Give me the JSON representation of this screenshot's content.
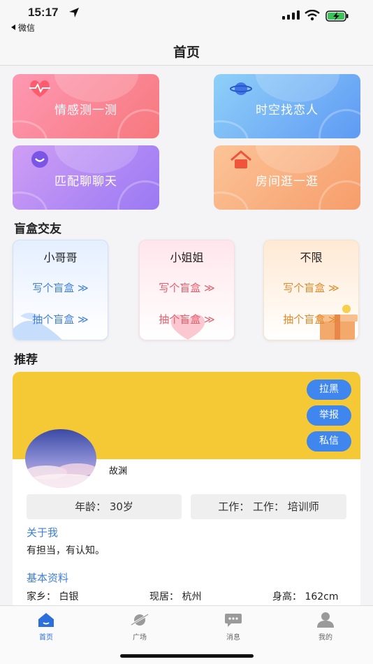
{
  "status_bar": {
    "time": "15:17",
    "back_app": "微信"
  },
  "nav": {
    "title": "首页"
  },
  "features": [
    {
      "label": "情感测一测",
      "icon": "heart-pulse-icon"
    },
    {
      "label": "时空找恋人",
      "icon": "planet-icon"
    },
    {
      "label": "匹配聊聊天",
      "icon": "smile-icon"
    },
    {
      "label": "房间逛一逛",
      "icon": "house-icon"
    }
  ],
  "blind_box": {
    "title": "盲盒交友",
    "cards": [
      {
        "title": "小哥哥",
        "write": "写个盲盒 ≫",
        "draw": "抽个盲盒 ≫",
        "accent": "#3f7fd9"
      },
      {
        "title": "小姐姐",
        "write": "写个盲盒 ≫",
        "draw": "抽个盲盒 ≫",
        "accent": "#e45e6a"
      },
      {
        "title": "不限",
        "write": "写个盲盒 ≫",
        "draw": "抽个盲盒 ≫",
        "accent": "#e08a2b"
      }
    ]
  },
  "recommend": {
    "title": "推荐",
    "actions": {
      "block": "拉黑",
      "report": "举报",
      "message": "私信"
    },
    "profile": {
      "name": "故渊",
      "age": "年龄：  30岁",
      "job": "工作：  工作：  培训师",
      "about_title": "关于我",
      "about_text": "有担当，有认知。",
      "basic_title": "基本资料",
      "hometown": "家乡：  白银",
      "residence": "现居：  杭州",
      "height": "身高：  162cm"
    },
    "banner_color": "#f5c935"
  },
  "tabs": [
    {
      "label": "首页",
      "icon": "home-icon",
      "active": true
    },
    {
      "label": "广场",
      "icon": "planet-ring-icon",
      "active": false
    },
    {
      "label": "消息",
      "icon": "chat-bubble-icon",
      "active": false
    },
    {
      "label": "我的",
      "icon": "user-icon",
      "active": false
    }
  ]
}
